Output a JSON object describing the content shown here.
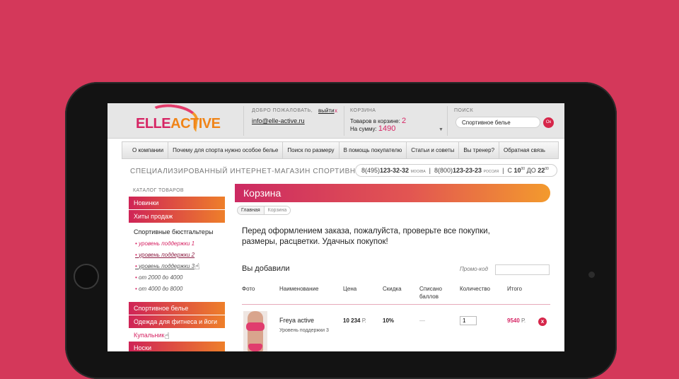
{
  "header": {
    "logo_elle": "ELLE",
    "logo_active": "ACTIVE",
    "welcome_caption": "ДОБРО ПОЖАЛОВАТЬ,",
    "logout_label": "выйти",
    "logout_x": "x",
    "email": "info@elle-active.ru",
    "cart_caption": "КОРЗИНА",
    "cart_items_label": "Товаров в корзине:",
    "cart_items_count": "2",
    "cart_sum_label": "На сумму:",
    "cart_sum_value": "1490",
    "search_caption": "ПОИСК",
    "search_value": "Спортивное белье",
    "search_button": "Ок"
  },
  "nav": {
    "items": [
      "О компании",
      "Почему для спорта нужно особое белье",
      "Поиск по размеру",
      "В помощь покупателю",
      "Статьи и советы",
      "Вы тренер?",
      "Обратная связь"
    ]
  },
  "tagline": "СПЕЦИАЛИЗИРОВАННЫЙ ИНТЕРНЕТ-МАГАЗИН СПОРТИВНОГО БЕЛЬЯ",
  "phones": {
    "moscow_code": "8(495)",
    "moscow_number": "123-32-32",
    "moscow_city": "МОСКВА",
    "russia_code": "8(800)",
    "russia_number": "123-23-23",
    "russia_city": "РОССИЯ",
    "hours_from_label": "С",
    "hours_from": "10",
    "hours_from_min": "00",
    "hours_to_label": "ДО",
    "hours_to": "22",
    "hours_to_min": "00"
  },
  "sidebar": {
    "caption": "КАТАЛОГ ТОВАРОВ",
    "top_items": [
      "Новинки",
      "Хиты продаж"
    ],
    "section_title": "Спортивные бюстгальтеры",
    "sub_items": [
      "уровень поддержки 1",
      "уровень поддержки 2",
      "уровень поддержки 3",
      "от 2000 до 4000",
      "от 4000 до 8000"
    ],
    "bottom_items": [
      "Спортивное белье",
      "Одежда для фитнеса и йоги"
    ],
    "pink_item": "Купальник",
    "last_item": "Носки"
  },
  "main": {
    "title": "Корзина",
    "breadcrumb_home": "Главная",
    "breadcrumb_current": "Корзина",
    "intro": "Перед оформлением заказа, пожалуйста, проверьте все покупки, размеры, расцветки. Удачных покупок!",
    "added_title": "Вы добавили",
    "promo_label": "Промо-код",
    "promo_value": ""
  },
  "table": {
    "headers": [
      "Фото",
      "Наименование",
      "Цена",
      "Скидка",
      "Списано баллов",
      "Количество",
      "Итого"
    ],
    "rows": [
      {
        "name": "Freya active",
        "variant": "Уровень поддержки 3",
        "price": "10 234",
        "currency": "Р.",
        "discount": "10%",
        "points": "—",
        "quantity": "1",
        "total": "9540",
        "total_currency": "Р.",
        "delete": "x"
      }
    ]
  },
  "colors": {
    "background": "#d4385a",
    "brand_pink": "#d62564",
    "brand_orange": "#f08418"
  },
  "icons": {
    "cursor": "hand-cursor-icon",
    "dropdown": "chevron-down-icon",
    "delete": "close-icon"
  }
}
